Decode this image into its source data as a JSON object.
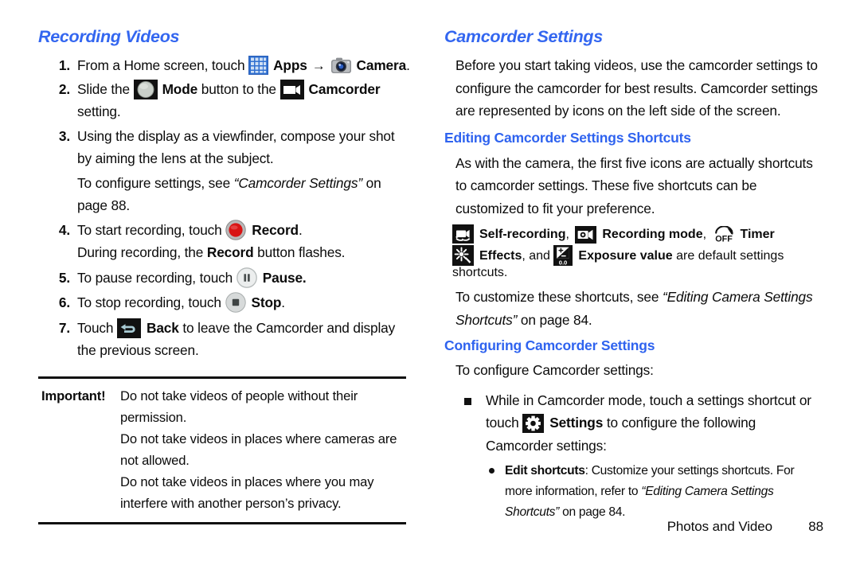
{
  "document": {
    "footer_section": "Photos and Video",
    "footer_page": "88"
  },
  "colors": {
    "heading_blue": "#3366f0",
    "subheading_blue": "#2f63ef",
    "text_black": "#0b0b0b",
    "apps_icon_blue": "#2f6fd0",
    "record_red": "#d81414"
  },
  "left_column": {
    "heading": "Recording Videos",
    "steps": [
      {
        "num": "1.",
        "parts": {
          "t1": "From a Home screen, touch ",
          "icon1": "apps-grid-icon",
          "b1": "Apps",
          "arrow": "→",
          "icon2": "camera-icon",
          "b2": "Camera",
          "t2": "."
        }
      },
      {
        "num": "2.",
        "parts": {
          "t1": "Slide the ",
          "icon1": "mode-circle-icon",
          "b1": "Mode",
          "t2": " button to the ",
          "icon2": "camcorder-icon",
          "b2": "Camcorder",
          "t3": "setting."
        }
      },
      {
        "num": "3.",
        "parts": {
          "t1": "Using the display as a viewfinder, compose your shot by aiming the lens at the subject.",
          "sub_t1": "To configure settings, see ",
          "sub_i1": "“Camcorder Settings”",
          "sub_t2": " on page 88."
        }
      },
      {
        "num": "4.",
        "parts": {
          "t1": "To start recording, touch ",
          "icon1": "record-button-icon",
          "b1": "Record",
          "t2": ".",
          "sub_t1": "During recording, the ",
          "sub_b1": "Record",
          "sub_t2": " button flashes."
        }
      },
      {
        "num": "5.",
        "parts": {
          "t1": "To pause recording, touch ",
          "icon1": "pause-button-icon",
          "b1": "Pause."
        }
      },
      {
        "num": "6.",
        "parts": {
          "t1": "To stop recording, touch ",
          "icon1": "stop-button-icon",
          "b1": "Stop",
          "t2": "."
        }
      },
      {
        "num": "7.",
        "parts": {
          "t1": "Touch ",
          "icon1": "back-button-icon",
          "b1": "Back",
          "t2": " to leave the Camcorder and display the previous screen."
        }
      }
    ],
    "important": {
      "label": "Important!",
      "lines": [
        "Do not take videos of people without their permission.",
        "Do not take videos in places where cameras are not allowed.",
        "Do not take videos in places where you may interfere with another person’s privacy."
      ]
    }
  },
  "right_column": {
    "heading": "Camcorder Settings",
    "intro": "Before you start taking videos, use the camcorder settings to configure the camcorder for best results. Camcorder settings are represented by icons on the left side of the screen.",
    "subheading_1": "Editing Camcorder Settings Shortcuts",
    "para_1": "As with the camera, the first five icons are actually shortcuts to camcorder settings. These five shortcuts can be customized to fit your preference.",
    "shortcut_line": {
      "icon1": "self-recording-icon",
      "b1": "Self-recording",
      "sep1": ", ",
      "icon2": "recording-mode-icon",
      "b2": "Recording mode",
      "sep2": ", ",
      "icon3": "timer-off-icon",
      "b3": "Timer",
      "icon4": "effects-icon",
      "b4": "Effects",
      "sep3": ", and ",
      "icon5": "exposure-value-icon",
      "b5": "Exposure value",
      "tail": " are default settings shortcuts."
    },
    "para_2": {
      "t1": "To customize these shortcuts, see ",
      "i1": "“Editing Camera Settings Shortcuts”",
      "t2": " on page 84."
    },
    "subheading_2": "Configuring Camcorder Settings",
    "para_3": "To configure Camcorder settings:",
    "bullet": {
      "t1": "While in Camcorder mode, touch a settings shortcut or touch ",
      "icon1": "settings-gear-icon",
      "b1": "Settings",
      "t2": " to configure the following Camcorder settings:"
    },
    "sub_bullet": {
      "b1": "Edit shortcuts",
      "t1": ": Customize your settings shortcuts. For more information, refer to ",
      "i1": "“Editing Camera Settings Shortcuts”",
      "t2": " on page 84."
    }
  }
}
